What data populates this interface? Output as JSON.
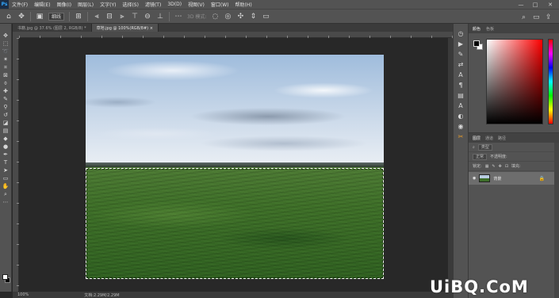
{
  "app": {
    "logo": "Ps"
  },
  "menu": [
    "文件(F)",
    "编辑(E)",
    "图像(I)",
    "图层(L)",
    "文字(Y)",
    "选择(S)",
    "滤镜(T)",
    "3D(D)",
    "视图(V)",
    "窗口(W)",
    "帮助(H)"
  ],
  "window_controls": {
    "minimize": "—",
    "maximize": "□",
    "close": "✕"
  },
  "options_bar": {
    "mode_select": "细线",
    "dim_hint": "3D 模式:",
    "search_icon": "search-icon",
    "workspace_icon": "workspace-icon",
    "share_icon": "share-icon"
  },
  "tabs": [
    {
      "label": "书籍.jpg @ 37.6% (图层 2, RGB/8) *",
      "active": false
    },
    {
      "label": "草地.jpg @ 100%(RGB/8#) ×",
      "active": true
    }
  ],
  "status": {
    "zoom": "100%",
    "doc": "文档:2.29M/2.29M"
  },
  "color_panel": {
    "tabs": [
      "颜色",
      "色板"
    ],
    "active": "颜色"
  },
  "layers_panel": {
    "tabs": [
      "图层",
      "通道",
      "路径"
    ],
    "active": "图层",
    "kind_filter": "类型",
    "blend_mode": "正常",
    "opacity_label": "不透明度:",
    "lock_label": "锁定:",
    "fill_label": "填充:",
    "layers": [
      {
        "name": "背景",
        "locked": true,
        "visible": true
      }
    ]
  },
  "watermark": "UiBQ.CoM"
}
